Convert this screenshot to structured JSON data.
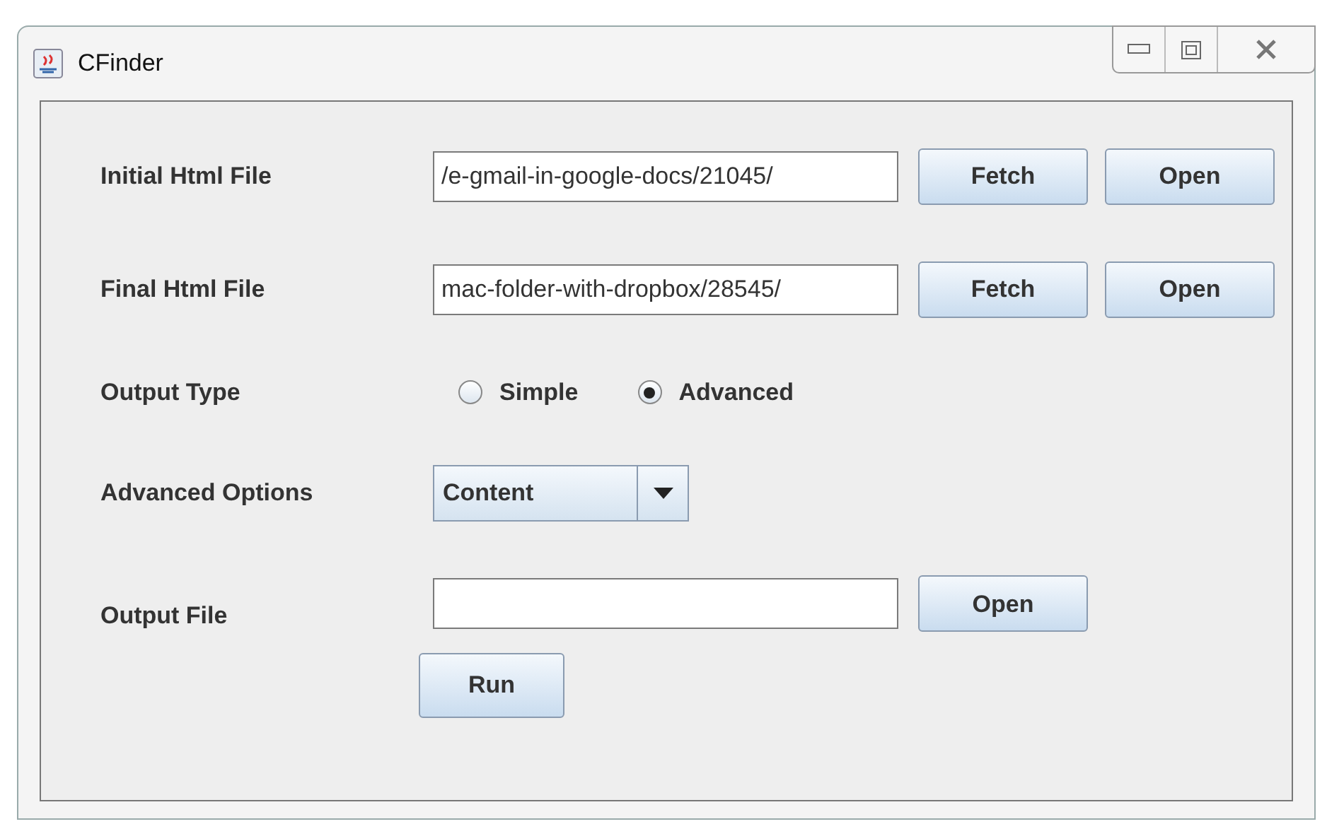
{
  "window": {
    "title": "CFinder"
  },
  "rows": [
    {
      "kind": "file",
      "label": "Initial Html File",
      "value": "/e-gmail-in-google-docs/21045/",
      "buttons": [
        "Fetch",
        "Open"
      ]
    },
    {
      "kind": "file",
      "label": "Final Html File",
      "value": "mac-folder-with-dropbox/28545/",
      "buttons": [
        "Fetch",
        "Open"
      ]
    },
    {
      "kind": "radio",
      "label": "Output Type",
      "options": [
        {
          "label": "Simple",
          "selected": false
        },
        {
          "label": "Advanced",
          "selected": true
        }
      ]
    },
    {
      "kind": "combo",
      "label": "Advanced Options",
      "value": "Content"
    },
    {
      "kind": "file",
      "label": "Output File",
      "value": "",
      "buttons": [
        "Open"
      ]
    }
  ],
  "run_button": "Run"
}
